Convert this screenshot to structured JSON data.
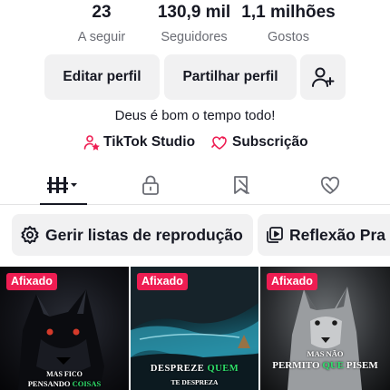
{
  "stats": {
    "following": {
      "value": "23",
      "label": "A seguir"
    },
    "followers": {
      "value": "130,9 mil",
      "label": "Seguidores"
    },
    "likes": {
      "value": "1,1 milhões",
      "label": "Gostos"
    }
  },
  "actions": {
    "edit_label": "Editar perfil",
    "share_label": "Partilhar perfil",
    "add_friend_icon": "add-user-icon"
  },
  "bio": "Deus é bom o tempo todo!",
  "links": {
    "studio_label": "TikTok Studio",
    "subscription_label": "Subscrição"
  },
  "tabs": {
    "items": [
      "videos-grid-icon",
      "lock-icon",
      "saved-icon",
      "liked-icon"
    ],
    "active": "videos-grid-icon"
  },
  "playlists": {
    "manage_label": "Gerir listas de reprodução",
    "playlist_label": "Reflexão Pra"
  },
  "videos": [
    {
      "badge": "Afixado",
      "caption_line1": "MAS FICO",
      "caption_line2_a": "PENSANDO ",
      "caption_line2_b": "COISAS"
    },
    {
      "badge": "Afixado",
      "caption_line1_a": "DESPREZE ",
      "caption_line1_b": "QUEM",
      "caption_line2": "TE DESPREZA"
    },
    {
      "badge": "Afixado",
      "caption_line1": "MAS NÃO",
      "caption_line2_a": "PERMITO ",
      "caption_line2_b": "QUE",
      "caption_line2_c": " PISEM"
    }
  ],
  "colors": {
    "text": "#161823",
    "muted": "#6b6d75",
    "button_bg": "#f1f1f2",
    "pinned_badge": "#ee1d52",
    "caption_highlight": "#2fe06b"
  }
}
